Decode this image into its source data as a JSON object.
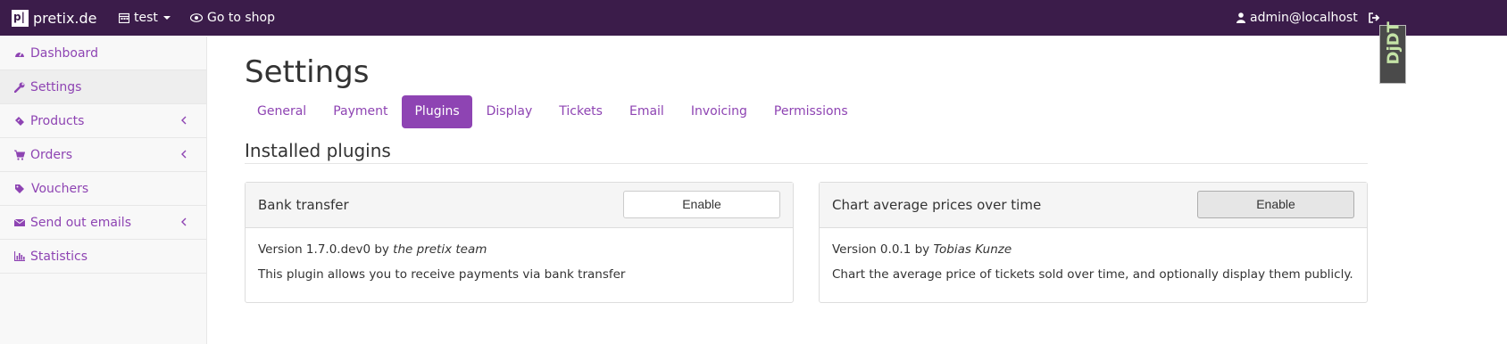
{
  "topbar": {
    "brand": "pretix.de",
    "event": "test",
    "shop_link": "Go to shop",
    "user": "admin@localhost"
  },
  "sidebar": {
    "items": [
      {
        "label": "Dashboard",
        "icon": "dashboard-icon"
      },
      {
        "label": "Settings",
        "icon": "wrench-icon"
      },
      {
        "label": "Products",
        "icon": "ticket-icon"
      },
      {
        "label": "Orders",
        "icon": "cart-icon"
      },
      {
        "label": "Vouchers",
        "icon": "tags-icon"
      },
      {
        "label": "Send out emails",
        "icon": "envelope-icon"
      },
      {
        "label": "Statistics",
        "icon": "bar-chart-icon"
      }
    ]
  },
  "main": {
    "title": "Settings",
    "tabs": [
      "General",
      "Payment",
      "Plugins",
      "Display",
      "Tickets",
      "Email",
      "Invoicing",
      "Permissions"
    ],
    "active_tab": "Plugins",
    "section_title": "Installed plugins"
  },
  "plugins": [
    {
      "name": "Bank transfer",
      "button": "Enable",
      "version_prefix": "Version 1.7.0.dev0 by ",
      "author": "the pretix team",
      "description": "This plugin allows you to receive payments via bank transfer"
    },
    {
      "name": "Chart average prices over time",
      "button": "Enable",
      "version_prefix": "Version 0.0.1 by ",
      "author": "Tobias Kunze",
      "description": "Chart the average price of tickets sold over time, and optionally display them publicly."
    }
  ],
  "debug_toolbar": "DjDT",
  "colors": {
    "topbar": "#3b1c4a",
    "accent": "#8e44b3"
  }
}
